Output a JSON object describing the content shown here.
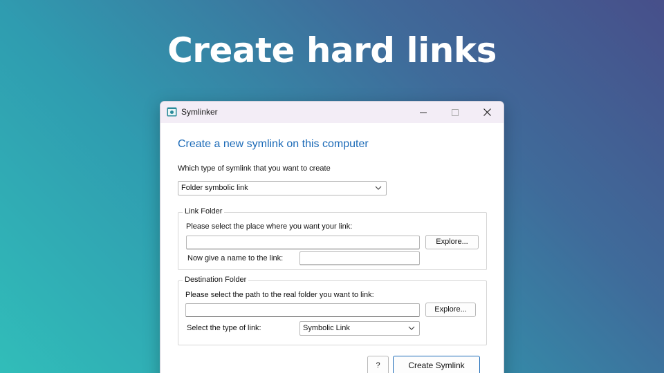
{
  "headline": "Create hard links",
  "window": {
    "title": "Symlinker"
  },
  "dialog": {
    "heading": "Create a new symlink on this computer",
    "type_prompt": "Which type of symlink that you want to create",
    "type_select": "Folder symbolic link",
    "link_group": {
      "title": "Link Folder",
      "place_prompt": "Please select the place where you want your link:",
      "place_value": "",
      "explore_label": "Explore...",
      "name_prompt": "Now give a name to the link:",
      "name_value": ""
    },
    "dest_group": {
      "title": "Destination Folder",
      "path_prompt": "Please select the path to the real folder you want to link:",
      "path_value": "",
      "explore_label": "Explore...",
      "link_type_prompt": "Select the type of link:",
      "link_type_select": "Symbolic Link"
    },
    "help_label": "?",
    "create_label": "Create Symlink"
  },
  "colors": {
    "accent": "#1b6ab7",
    "titlebar": "#f3edf6"
  }
}
